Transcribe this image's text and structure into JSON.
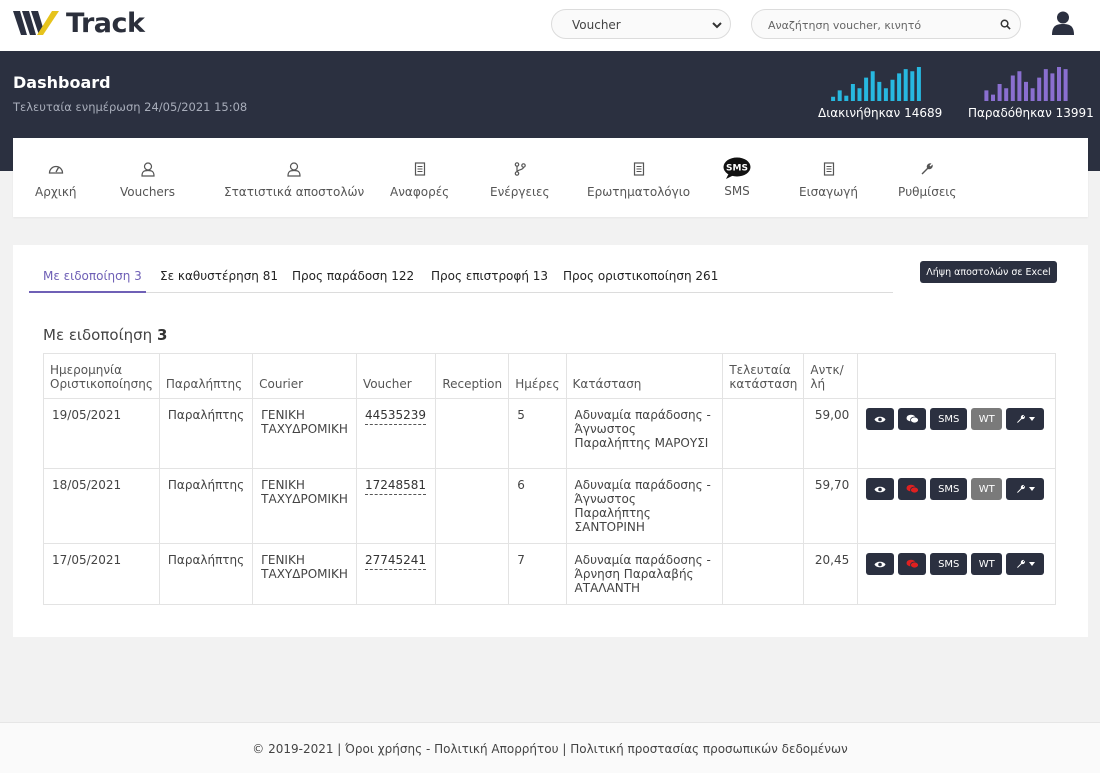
{
  "brand": {
    "name": "Track",
    "colors": {
      "dark": "#2b3040",
      "accent": "#6f60b6",
      "yellow": "#e6c31c",
      "cyan": "#27b8e0",
      "purple": "#8a6fd0"
    }
  },
  "topbar": {
    "select_value": "Voucher",
    "search_placeholder": "Αναζήτηση voucher, κινητό"
  },
  "header": {
    "title": "Dashboard",
    "subtitle": "Τελευταία ενημέρωση 24/05/2021 15:08",
    "stat_moved_label": "Διακινήθηκαν 14689",
    "stat_delivered_label": "Παραδόθηκαν 13991",
    "stat_moved_bars": [
      4,
      10,
      5,
      16,
      12,
      22,
      28,
      18,
      12,
      20,
      26,
      30,
      28,
      32
    ],
    "stat_delivered_bars": [
      10,
      6,
      16,
      12,
      24,
      28,
      18,
      12,
      22,
      30,
      26,
      32,
      30
    ]
  },
  "nav": {
    "items": [
      {
        "label": "Αρχική",
        "icon": "gauge-icon"
      },
      {
        "label": "Vouchers",
        "icon": "user-outline-icon"
      },
      {
        "label": "Στατιστικά αποστολών",
        "icon": "user-outline-icon"
      },
      {
        "label": "Αναφορές",
        "icon": "receipt-icon"
      },
      {
        "label": "Ενέργειες",
        "icon": "branch-icon"
      },
      {
        "label": "Ερωτηματολόγιο",
        "icon": "receipt-icon"
      },
      {
        "label": "SMS",
        "icon": "sms-bubble-icon"
      },
      {
        "label": "Εισαγωγή",
        "icon": "receipt-icon"
      },
      {
        "label": "Ρυθμίσεις",
        "icon": "wrench-icon"
      }
    ]
  },
  "tabs": [
    "Με ειδοποίηση 3",
    "Σε καθυστέρηση 81",
    "Προς παράδοση 122",
    "Προς επιστροφή 13",
    "Προς οριστικοποίηση 261"
  ],
  "excel_button": "Λήψη αποστολών σε Excel",
  "section": {
    "title": "Με ειδοποίηση",
    "count": "3"
  },
  "table": {
    "headers": [
      "Ημερομηνία Οριστικοποίησης",
      "Παραλήπτης",
      "Courier",
      "Voucher",
      "Reception",
      "Ημέρες",
      "Κατάσταση",
      "Τελευταία κατάσταση",
      "Αντκ/λή",
      ""
    ],
    "rows": [
      {
        "date": "19/05/2021",
        "recipient": "Παραλήπτης",
        "courier": "ΓΕΝΙΚΗ ΤΑΧΥΔΡΟΜΙΚΗ",
        "voucher": "44535239",
        "reception": "",
        "days": "5",
        "status": "Αδυναμία παράδοσης - Άγνωστος Παραλήπτης ΜΑΡΟΥΣΙ",
        "last_status": "",
        "cod": "59,00",
        "chat_red": false,
        "wt_grey": true
      },
      {
        "date": "18/05/2021",
        "recipient": "Παραλήπτης",
        "courier": "ΓΕΝΙΚΗ ΤΑΧΥΔΡΟΜΙΚΗ",
        "voucher": "17248581",
        "reception": "",
        "days": "6",
        "status": "Αδυναμία παράδοσης - Άγνωστος Παραλήπτης ΣΑΝΤΟΡΙΝΗ",
        "last_status": "",
        "cod": "59,70",
        "chat_red": true,
        "wt_grey": true
      },
      {
        "date": "17/05/2021",
        "recipient": "Παραλήπτης",
        "courier": "ΓΕΝΙΚΗ ΤΑΧΥΔΡΟΜΙΚΗ",
        "voucher": "27745241",
        "reception": "",
        "days": "7",
        "status": "Αδυναμία παράδοσης - Άρνηση Παραλαβής ΑΤΑΛΑΝΤΗ",
        "last_status": "",
        "cod": "20,45",
        "chat_red": true,
        "wt_grey": false
      }
    ],
    "action_labels": {
      "sms": "SMS",
      "wt": "WT"
    }
  },
  "footer": {
    "text": "© 2019-2021 | Όροι χρήσης - Πολιτική Απορρήτου | Πολιτική προστασίας προσωπικών δεδομένων"
  }
}
